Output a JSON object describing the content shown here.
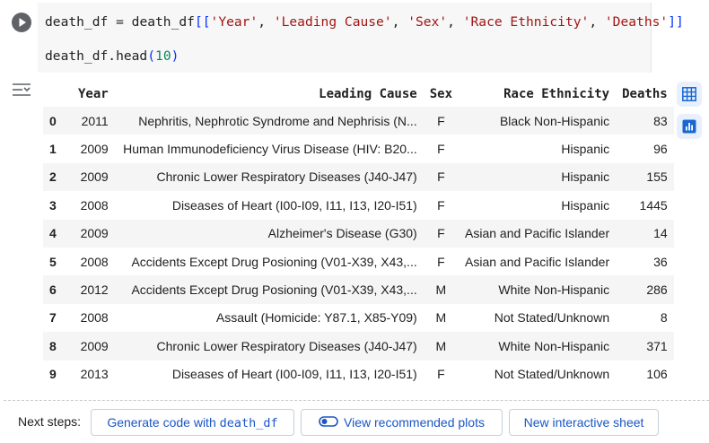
{
  "code": {
    "line1": {
      "var": "death_df",
      "assign": " = ",
      "obj": "death_df",
      "open": "[[",
      "columns": [
        "'Year'",
        "'Leading Cause'",
        "'Sex'",
        "'Race Ethnicity'",
        "'Deaths'"
      ],
      "sep": ", ",
      "close": "]]"
    },
    "line2": {
      "call": "death_df.head",
      "open": "(",
      "arg": "10",
      "close": ")"
    }
  },
  "table": {
    "headers": [
      "Year",
      "Leading Cause",
      "Sex",
      "Race Ethnicity",
      "Deaths"
    ],
    "rows": [
      {
        "idx": "0",
        "year": "2011",
        "cause": "Nephritis, Nephrotic Syndrome and Nephrisis (N...",
        "sex": "F",
        "race": "Black Non-Hispanic",
        "deaths": "83"
      },
      {
        "idx": "1",
        "year": "2009",
        "cause": "Human Immunodeficiency Virus Disease (HIV: B20...",
        "sex": "F",
        "race": "Hispanic",
        "deaths": "96"
      },
      {
        "idx": "2",
        "year": "2009",
        "cause": "Chronic Lower Respiratory Diseases (J40-J47)",
        "sex": "F",
        "race": "Hispanic",
        "deaths": "155"
      },
      {
        "idx": "3",
        "year": "2008",
        "cause": "Diseases of Heart (I00-I09, I11, I13, I20-I51)",
        "sex": "F",
        "race": "Hispanic",
        "deaths": "1445"
      },
      {
        "idx": "4",
        "year": "2009",
        "cause": "Alzheimer's Disease (G30)",
        "sex": "F",
        "race": "Asian and Pacific Islander",
        "deaths": "14"
      },
      {
        "idx": "5",
        "year": "2008",
        "cause": "Accidents Except Drug Posioning (V01-X39, X43,...",
        "sex": "F",
        "race": "Asian and Pacific Islander",
        "deaths": "36"
      },
      {
        "idx": "6",
        "year": "2012",
        "cause": "Accidents Except Drug Posioning (V01-X39, X43,...",
        "sex": "M",
        "race": "White Non-Hispanic",
        "deaths": "286"
      },
      {
        "idx": "7",
        "year": "2008",
        "cause": "Assault (Homicide: Y87.1, X85-Y09)",
        "sex": "M",
        "race": "Not Stated/Unknown",
        "deaths": "8"
      },
      {
        "idx": "8",
        "year": "2009",
        "cause": "Chronic Lower Respiratory Diseases (J40-J47)",
        "sex": "M",
        "race": "White Non-Hispanic",
        "deaths": "371"
      },
      {
        "idx": "9",
        "year": "2013",
        "cause": "Diseases of Heart (I00-I09, I11, I13, I20-I51)",
        "sex": "F",
        "race": "Not Stated/Unknown",
        "deaths": "106"
      }
    ]
  },
  "next_steps": {
    "label": "Next steps:",
    "generate_prefix": "Generate code with ",
    "generate_var": "death_df",
    "recommended_plots": "View recommended plots",
    "interactive_sheet": "New interactive sheet"
  },
  "icons": {
    "run": "play-icon",
    "filter": "filter-list-icon",
    "table_view": "table-grid-icon",
    "chart_view": "bar-chart-icon",
    "toggle": "toggle-icon"
  },
  "colors": {
    "accent": "#1a56c4",
    "side_button_bg": "#e8f0fe",
    "side_button_icon": "#1967d2",
    "string": "#a31515",
    "number": "#098658",
    "row_stripe": "#f5f5f5"
  }
}
